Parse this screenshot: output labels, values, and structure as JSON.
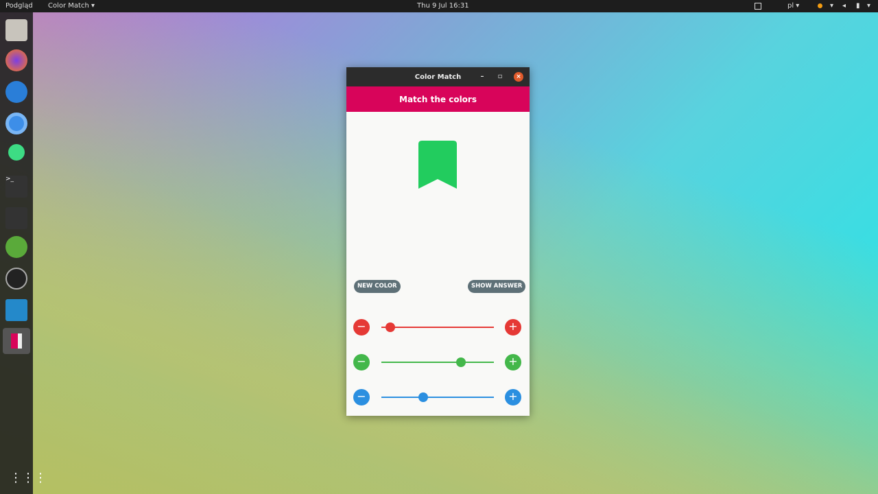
{
  "topbar": {
    "activities": "Podgląd",
    "app_menu": "Color Match ▾",
    "clock": "Thu 9 Jul  16:31",
    "lang": "pl ▾",
    "indicator_color": "#f39c12"
  },
  "dock": {
    "apps": [
      "files",
      "firefox",
      "thunderbird",
      "chromium",
      "android-studio",
      "terminal",
      "system-monitor",
      "app-7",
      "inkscape",
      "vscode",
      "color-match"
    ],
    "show_apps_icon": "grid-icon"
  },
  "window": {
    "title": "Color Match",
    "minimize": "–",
    "maximize": "▫",
    "close": "×"
  },
  "app": {
    "header": "Match the colors",
    "header_color": "#d8045a",
    "target_color": "#22cc5e",
    "new_color_label": "NEW COLOR",
    "show_answer_label": "SHOW ANSWER",
    "sliders": [
      {
        "channel": "red",
        "color": "#e53935",
        "value": 0.08
      },
      {
        "channel": "green",
        "color": "#43b74a",
        "value": 0.71
      },
      {
        "channel": "blue",
        "color": "#2b8fe0",
        "value": 0.37
      }
    ],
    "minus": "−",
    "plus": "+"
  }
}
